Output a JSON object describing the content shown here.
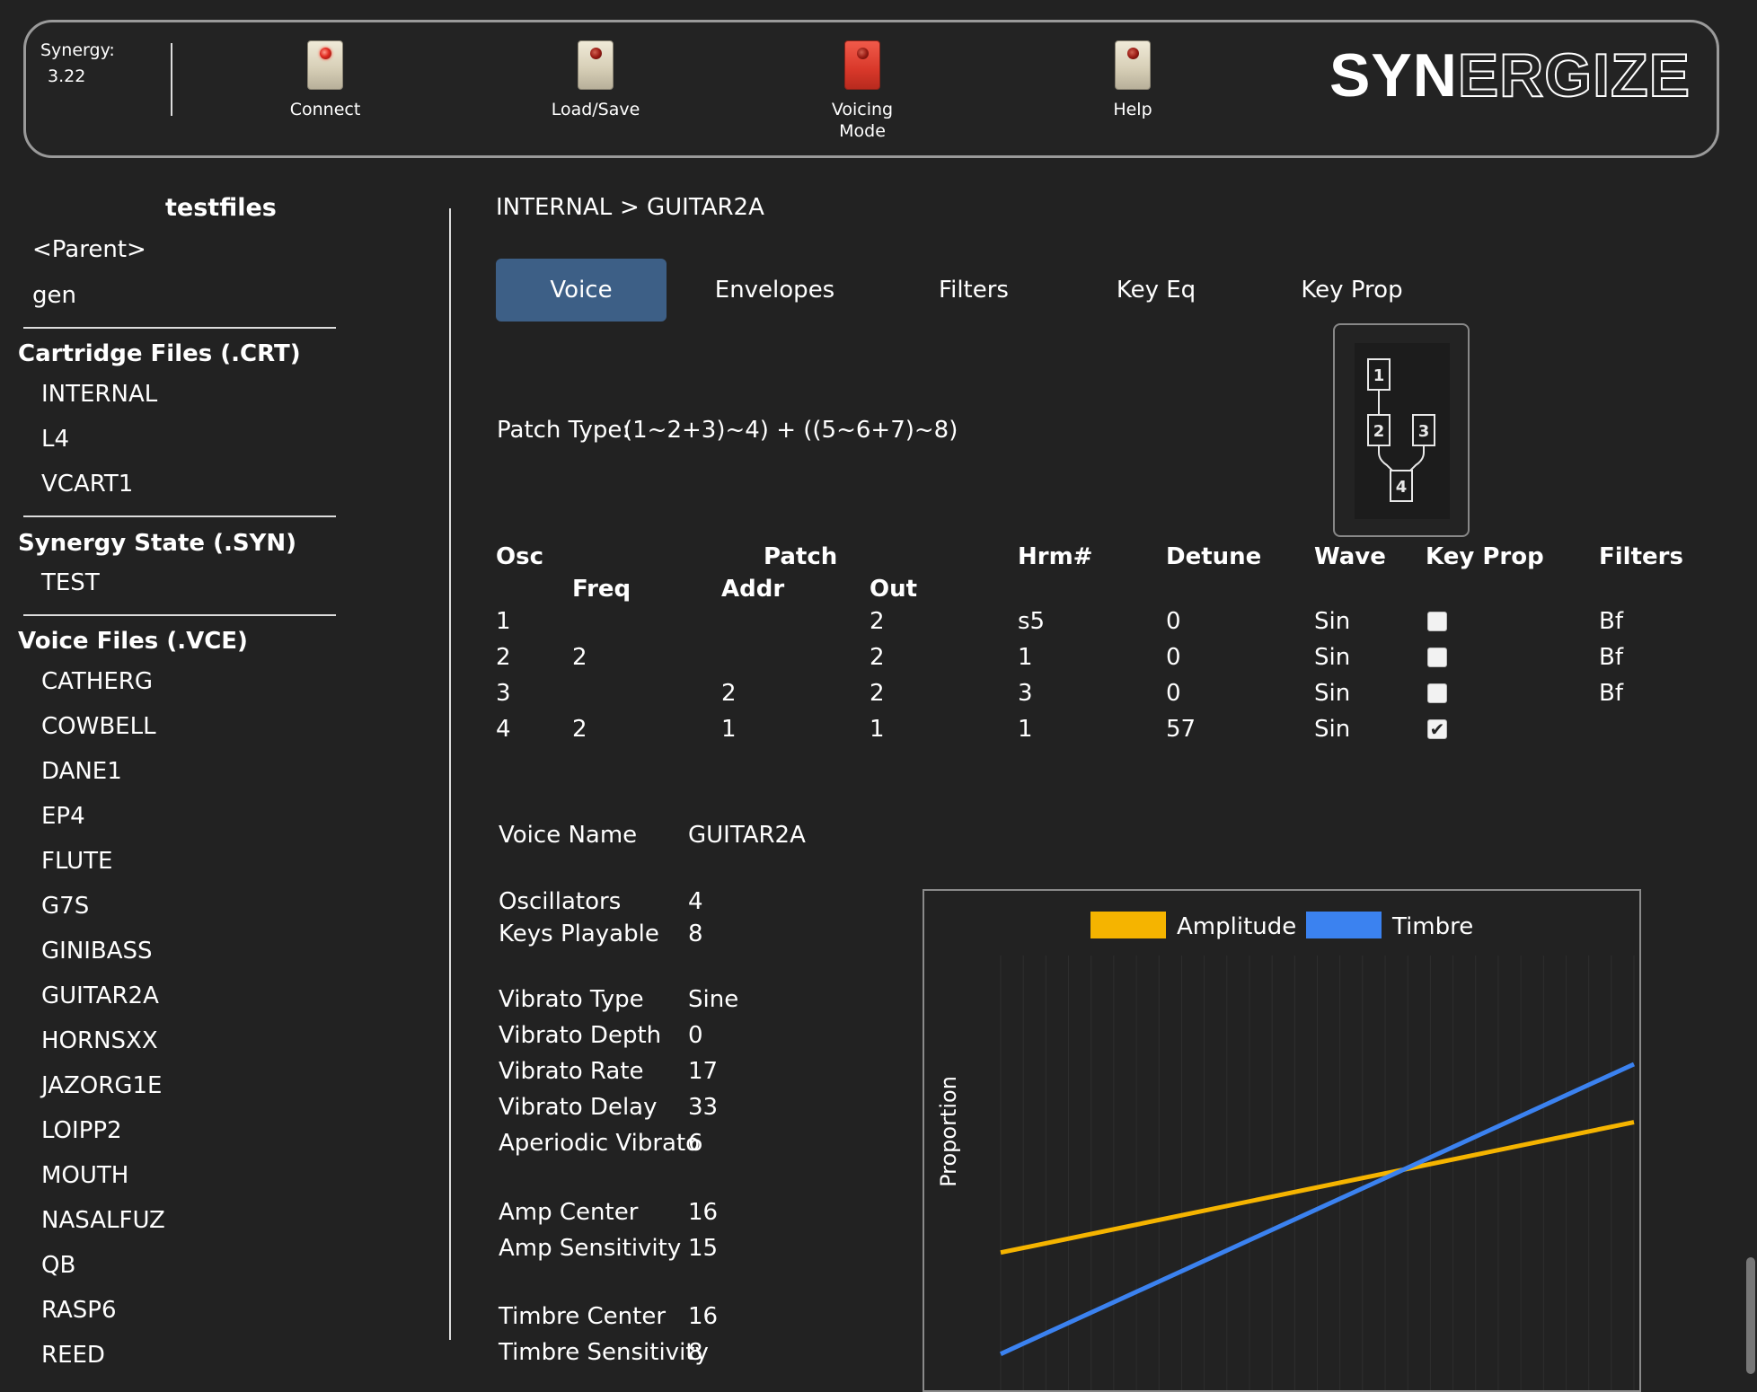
{
  "header": {
    "version_label": "Synergy:",
    "version_value": "3.22",
    "buttons": [
      {
        "label": "Connect"
      },
      {
        "label": "Load/Save"
      },
      {
        "label": "Voicing\nMode"
      },
      {
        "label": "Help"
      }
    ],
    "logo_solid": "SYN",
    "logo_outline": "ERGIZE"
  },
  "sidebar": {
    "title": "testfiles",
    "nav_items": [
      "<Parent>",
      "gen"
    ],
    "sections": [
      {
        "heading": "Cartridge Files (.CRT)",
        "items": [
          "INTERNAL",
          "L4",
          "VCART1"
        ]
      },
      {
        "heading": "Synergy State (.SYN)",
        "items": [
          "TEST"
        ]
      },
      {
        "heading": "Voice Files (.VCE)",
        "items": [
          "CATHERG",
          "COWBELL",
          "DANE1",
          "EP4",
          "FLUTE",
          "G7S",
          "GINIBASS",
          "GUITAR2A",
          "HORNSXX",
          "JAZORG1E",
          "LOIPP2",
          "MOUTH",
          "NASALFUZ",
          "QB",
          "RASP6",
          "REED"
        ]
      }
    ]
  },
  "breadcrumb": {
    "root": "INTERNAL",
    "separator": ">",
    "current": "GUITAR2A"
  },
  "tabs": [
    "Voice",
    "Envelopes",
    "Filters",
    "Key Eq",
    "Key Prop"
  ],
  "patch_type": {
    "label": "Patch Type:",
    "value": "(1~2+3)~4) + ((5~6+7)~8)"
  },
  "patch_diagram": {
    "boxes": [
      "1",
      "2",
      "3",
      "4"
    ]
  },
  "osc_table": {
    "group_header": "Patch",
    "headers": [
      "Osc",
      "Freq",
      "Addr",
      "Out",
      "Hrm#",
      "Detune",
      "Wave",
      "Key Prop",
      "Filters"
    ],
    "rows": [
      {
        "osc": "1",
        "freq": "",
        "addr": "",
        "out": "2",
        "hrm": "s5",
        "detune": "0",
        "wave": "Sin",
        "keyprop": false,
        "filters": "Bf"
      },
      {
        "osc": "2",
        "freq": "2",
        "addr": "",
        "out": "2",
        "hrm": "1",
        "detune": "0",
        "wave": "Sin",
        "keyprop": false,
        "filters": "Bf"
      },
      {
        "osc": "3",
        "freq": "",
        "addr": "2",
        "out": "2",
        "hrm": "3",
        "detune": "0",
        "wave": "Sin",
        "keyprop": false,
        "filters": "Bf"
      },
      {
        "osc": "4",
        "freq": "2",
        "addr": "1",
        "out": "1",
        "hrm": "1",
        "detune": "57",
        "wave": "Sin",
        "keyprop": true,
        "filters": ""
      }
    ]
  },
  "voice_params": [
    {
      "label": "Voice Name",
      "value": "GUITAR2A"
    },
    {
      "label": "Oscillators",
      "value": "4"
    },
    {
      "label": "Keys Playable",
      "value": "8"
    },
    {
      "label": "Vibrato Type",
      "value": "Sine"
    },
    {
      "label": "Vibrato Depth",
      "value": "0"
    },
    {
      "label": "Vibrato Rate",
      "value": "17"
    },
    {
      "label": "Vibrato Delay",
      "value": "33"
    },
    {
      "label": "Aperiodic Vibrato",
      "value": "6"
    },
    {
      "label": "Amp Center",
      "value": "16"
    },
    {
      "label": "Amp Sensitivity",
      "value": "15"
    },
    {
      "label": "Timbre Center",
      "value": "16"
    },
    {
      "label": "Timbre Sensitivity",
      "value": "8"
    }
  ],
  "chart_data": {
    "type": "line",
    "title": "",
    "xlabel": "",
    "ylabel": "Proportion",
    "legend_position": "top",
    "grid": true,
    "x": [
      0,
      1
    ],
    "series": [
      {
        "name": "Amplitude",
        "color": "#f5b400",
        "values": [
          0.38,
          0.74
        ]
      },
      {
        "name": "Timbre",
        "color": "#3b82f0",
        "values": [
          0.1,
          0.9
        ]
      }
    ],
    "ylim": [
      0,
      1.2
    ]
  }
}
